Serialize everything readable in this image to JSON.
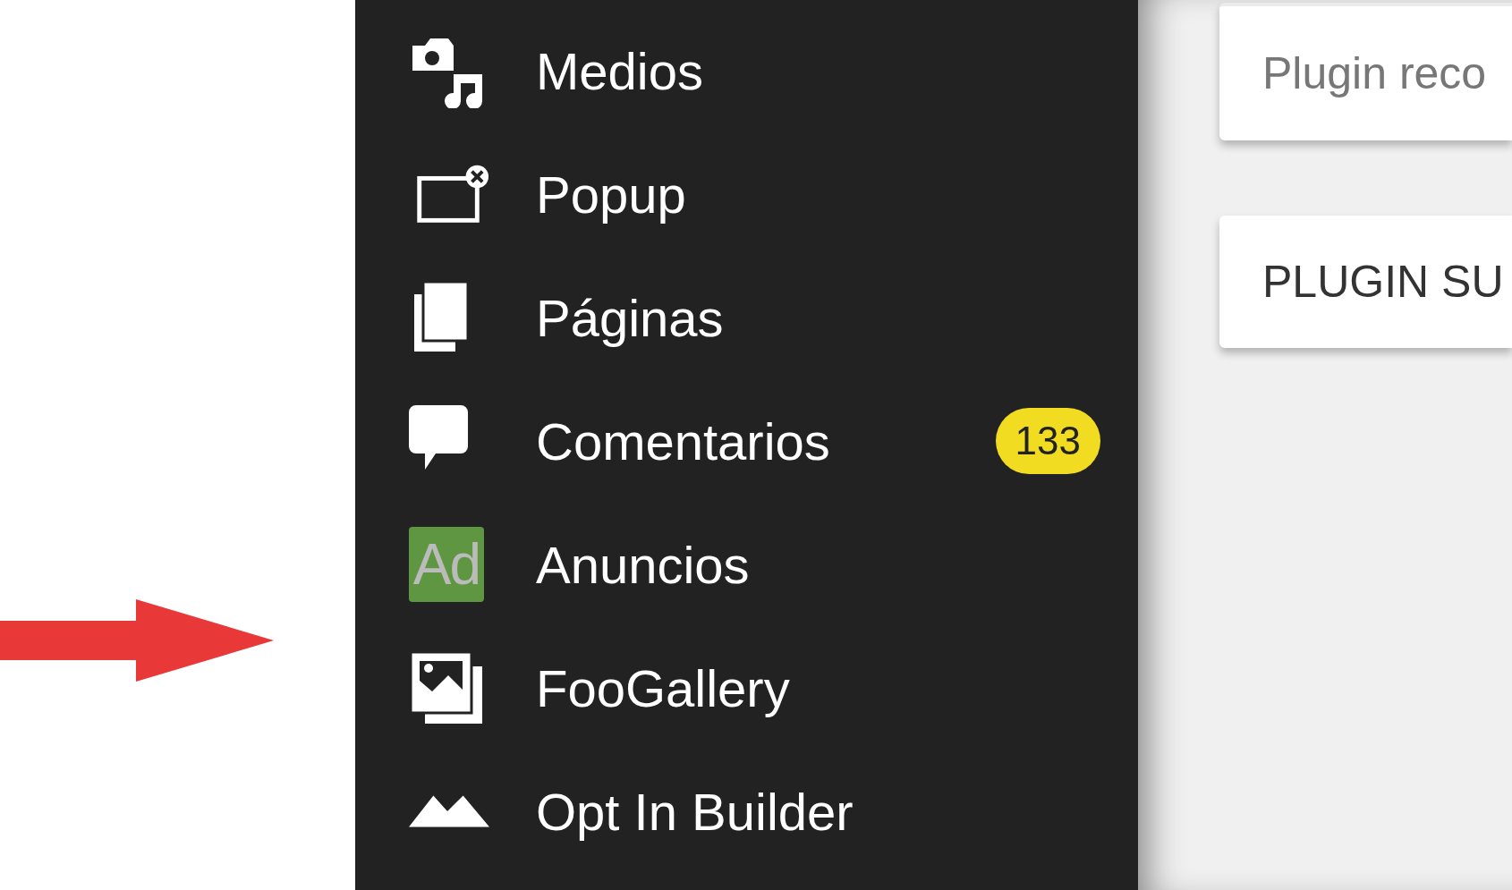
{
  "sidebar": {
    "items": [
      {
        "label": "Medios",
        "kind": "media"
      },
      {
        "label": "Popup",
        "kind": "popup"
      },
      {
        "label": "Páginas",
        "kind": "pages"
      },
      {
        "label": "Comentarios",
        "kind": "comments",
        "badge": "133"
      },
      {
        "label": "Anuncios",
        "kind": "ads",
        "icon_text": "Ad"
      },
      {
        "label": "FooGallery",
        "kind": "gallery"
      },
      {
        "label": "Opt In Builder",
        "kind": "optin"
      }
    ]
  },
  "cards": [
    {
      "text": "Plugin reco",
      "kind": "note"
    },
    {
      "text": "PLUGIN SU",
      "kind": "heading"
    }
  ]
}
